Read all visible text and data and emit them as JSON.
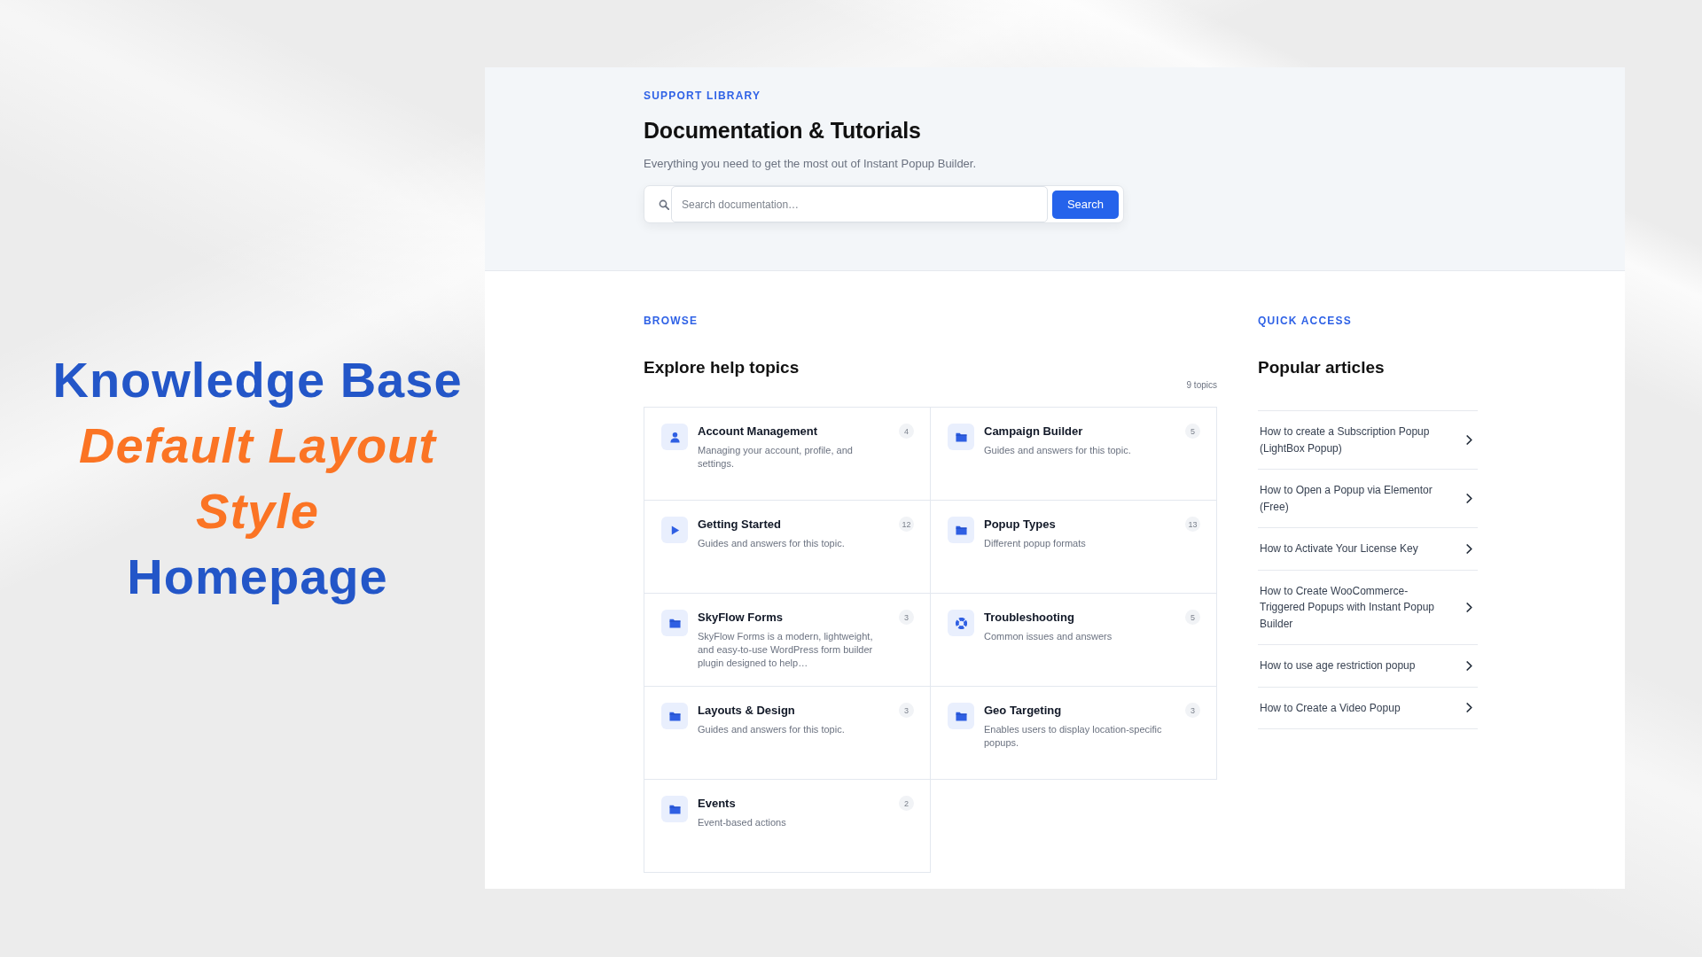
{
  "headline": [
    {
      "text": "Knowledge Base",
      "kind": "plain"
    },
    {
      "text": "Default Layout",
      "kind": "accent"
    },
    {
      "text": "Style",
      "kind": "accent"
    },
    {
      "text": "Homepage",
      "kind": "plain"
    }
  ],
  "header": {
    "eyebrow": "SUPPORT LIBRARY",
    "title": "Documentation & Tutorials",
    "subtitle": "Everything you need to get the most out of Instant Popup Builder.",
    "search": {
      "placeholder": "Search documentation…",
      "button": "Search"
    }
  },
  "browse": {
    "eyebrow": "BROWSE",
    "title": "Explore help topics",
    "topic_count": "9 topics",
    "topics": [
      {
        "title": "Account Management",
        "description": "Managing your account, profile, and settings.",
        "count": "4",
        "kind": "profile"
      },
      {
        "title": "Campaign Builder",
        "description": "Guides and answers for this topic.",
        "count": "5",
        "kind": "category"
      },
      {
        "title": "Getting Started",
        "description": "Guides and answers for this topic.",
        "count": "12",
        "kind": "video"
      },
      {
        "title": "Popup Types",
        "description": "Different popup formats",
        "count": "13",
        "kind": "category"
      },
      {
        "title": "SkyFlow Forms",
        "description": "SkyFlow Forms is a modern, lightweight, and easy-to-use WordPress form builder plugin designed to help…",
        "count": "3",
        "kind": "category"
      },
      {
        "title": "Troubleshooting",
        "description": "Common issues and answers",
        "count": "5",
        "kind": "support"
      },
      {
        "title": "Layouts & Design",
        "description": "Guides and answers for this topic.",
        "count": "3",
        "kind": "category"
      },
      {
        "title": "Geo Targeting",
        "description": "Enables users to display location-specific popups.",
        "count": "3",
        "kind": "category"
      },
      {
        "title": "Events",
        "description": "Event-based actions",
        "count": "2",
        "kind": "category"
      }
    ]
  },
  "quick_access": {
    "eyebrow": "QUICK ACCESS",
    "title": "Popular articles",
    "articles": [
      "How to create a Subscription Popup (LightBox Popup)",
      "How to Open a Popup via Elementor (Free)",
      "How to Activate Your License Key",
      "How to Create WooCommerce-Triggered Popups with Instant Popup Builder",
      "How to use age restriction popup",
      "How to Create a Video Popup"
    ]
  }
}
